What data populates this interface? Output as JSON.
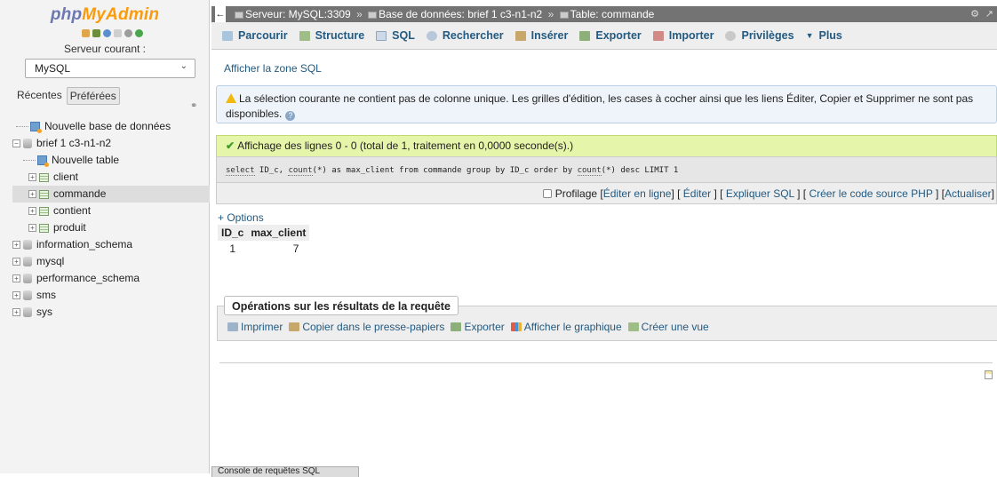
{
  "nav": {
    "logo_php": "php",
    "logo_myadmin": "MyAdmin",
    "server_label": "Serveur courant :",
    "server_value": "MySQL",
    "tabs": [
      "Récentes",
      "Préférées"
    ],
    "tree": [
      {
        "label": "Nouvelle base de données"
      },
      {
        "label": "brief 1 c3-n1-n2"
      },
      {
        "label": "Nouvelle table"
      },
      {
        "label": "client"
      },
      {
        "label": "commande"
      },
      {
        "label": "contient"
      },
      {
        "label": "produit"
      },
      {
        "label": "information_schema"
      },
      {
        "label": "mysql"
      },
      {
        "label": "performance_schema"
      },
      {
        "label": "sms"
      },
      {
        "label": "sys"
      }
    ]
  },
  "breadcrumb": {
    "server": "Serveur: MySQL:3309",
    "database": "Base de données: brief 1 c3-n1-n2",
    "table": "Table: commande",
    "separator": "»"
  },
  "menu": {
    "tabs": [
      "Parcourir",
      "Structure",
      "SQL",
      "Rechercher",
      "Insérer",
      "Exporter",
      "Importer",
      "Privilèges",
      "Plus"
    ]
  },
  "sql_toggle": "Afficher la zone SQL",
  "notice": {
    "text": "La sélection courante ne contient pas de colonne unique. Les grilles d'édition, les cases à cocher ainsi que les liens Éditer, Copier et Supprimer ne sont pas disponibles."
  },
  "success": {
    "text": "Affichage des lignes 0 - 0 (total de 1, traitement en 0,0000 seconde(s).)"
  },
  "query": {
    "select": "select",
    "p1": " ID_c, ",
    "count1": "count",
    "p2": "(*) as max_client from commande group by ID_c order by ",
    "count2": "count",
    "p3": "(*) desc LIMIT 1"
  },
  "profil": {
    "profilage": "Profilage",
    "links": [
      "Éditer en ligne",
      "Éditer",
      "Expliquer SQL",
      "Créer le code source PHP",
      "Actualiser"
    ]
  },
  "options_label": "+ Options",
  "results": {
    "columns": [
      "ID_c",
      "max_client"
    ],
    "rows": [
      [
        "1",
        "7"
      ]
    ]
  },
  "operations": {
    "legend": "Opérations sur les résultats de la requête",
    "items": [
      "Imprimer",
      "Copier dans le presse-papiers",
      "Exporter",
      "Afficher le graphique",
      "Créer une vue"
    ]
  },
  "console": "Console de requêtes SQL"
}
